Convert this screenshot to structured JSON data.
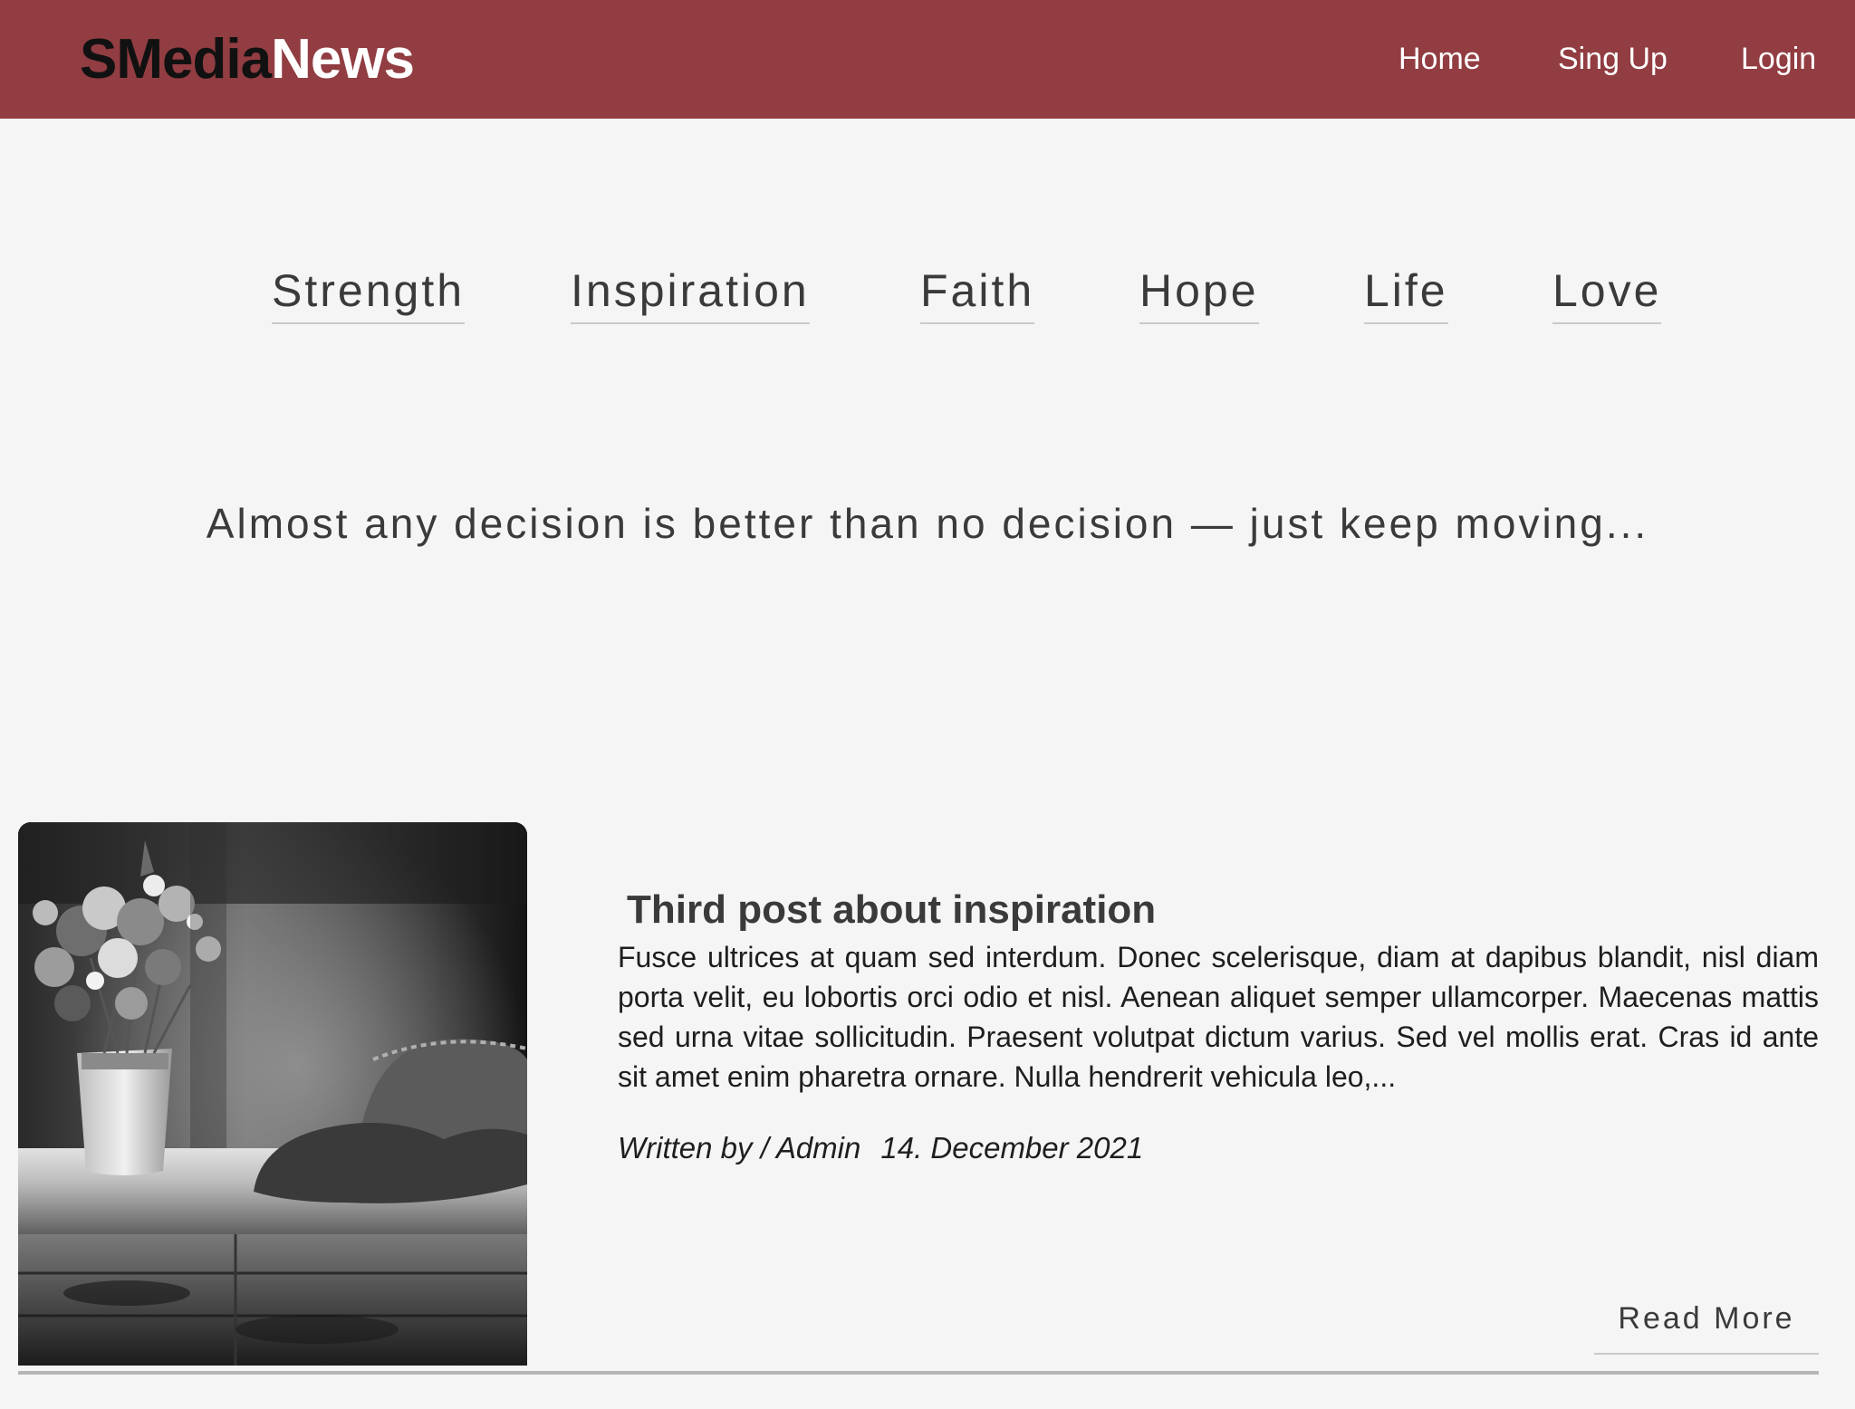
{
  "header": {
    "brand_part1": "SMedia",
    "brand_part2": "News",
    "nav": [
      "Home",
      "Sing Up",
      "Login"
    ],
    "background_color": "#913d42"
  },
  "categories": [
    "Strength",
    "Inspiration",
    "Faith",
    "Hope",
    "Life",
    "Love"
  ],
  "quote": "Almost any decision is better than no decision — just keep moving...",
  "post": {
    "image_icon": "flowers-vase-hat-photo",
    "title": "Third post about inspiration",
    "excerpt": "Fusce ultrices at quam sed interdum. Donec scelerisque, diam at dapibus blandit, nisl diam porta velit, eu lobortis orci odio et nisl. Aenean aliquet semper ullamcorper. Maecenas mattis sed urna vitae sollicitudin. Praesent volutpat dictum varius. Sed vel mollis erat. Cras id ante sit amet enim pharetra ornare. Nulla hendrerit vehicula leo,...",
    "author": "Written by / Admin",
    "date": "14. December 2021",
    "read_more": "Read More"
  }
}
